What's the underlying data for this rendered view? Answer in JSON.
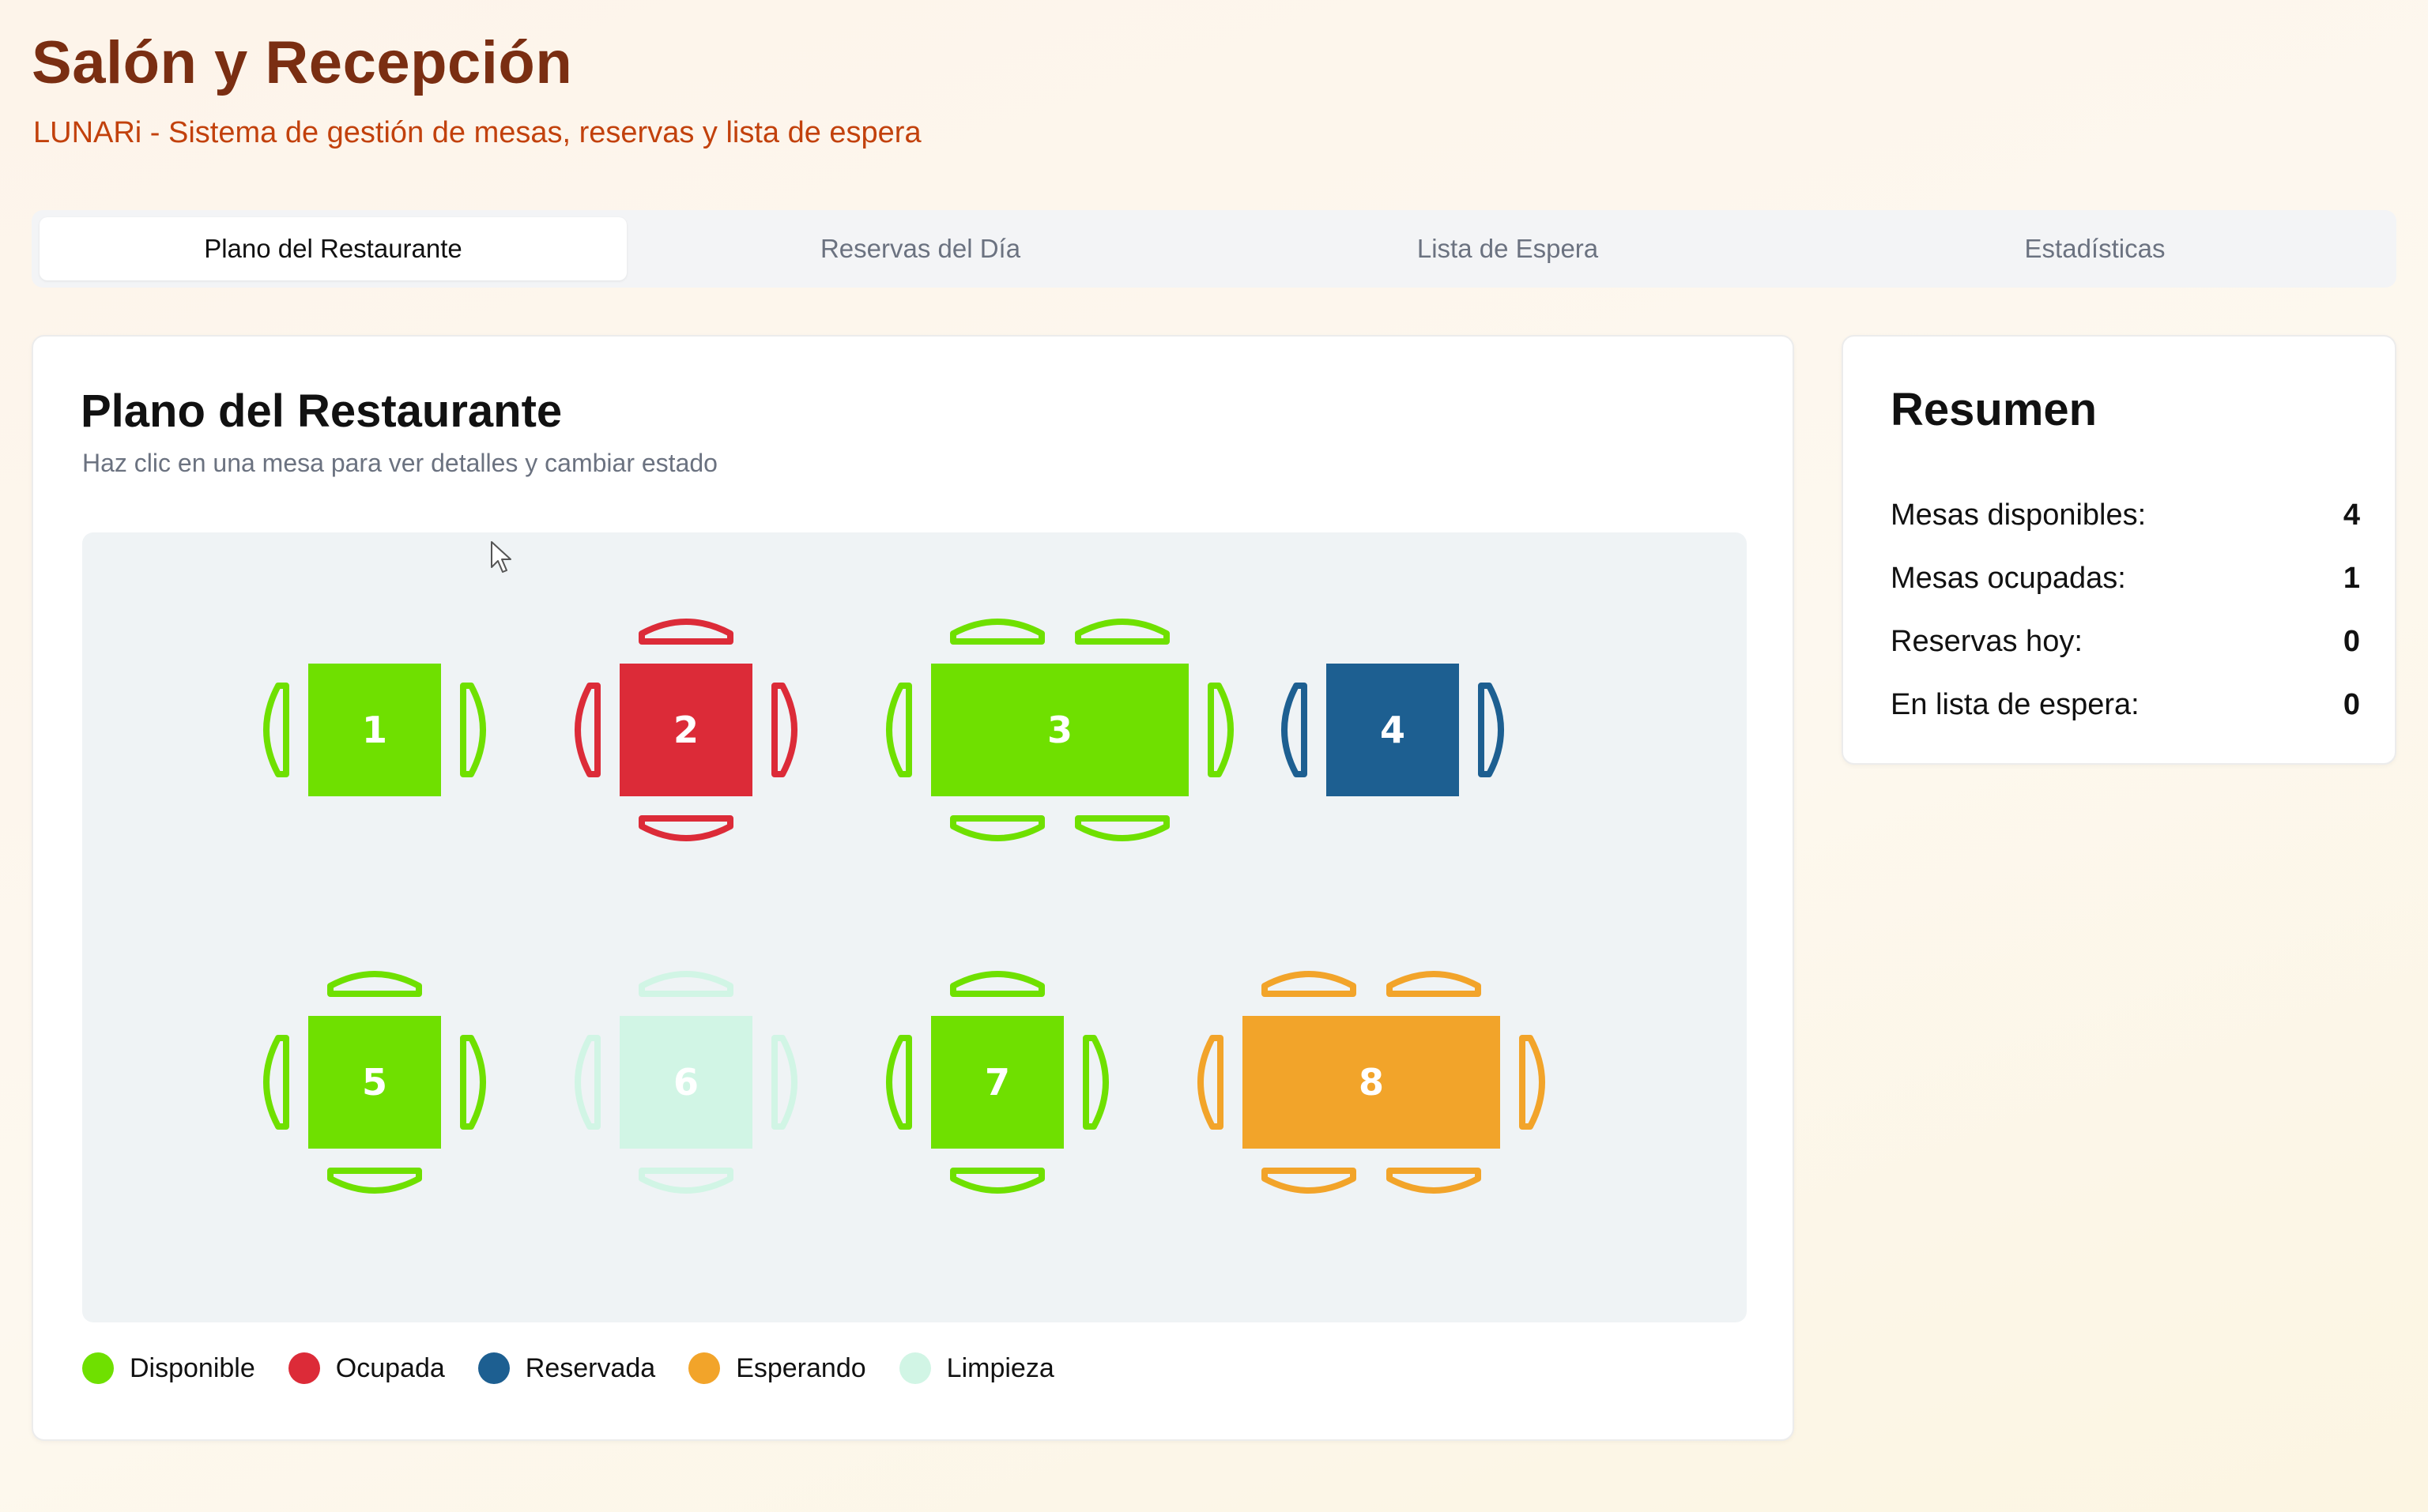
{
  "header": {
    "title": "Salón y Recepción",
    "subtitle": "LUNARi - Sistema de gestión de mesas, reservas y lista de espera"
  },
  "tabs": [
    {
      "label": "Plano del Restaurante",
      "active": true
    },
    {
      "label": "Reservas del Día",
      "active": false
    },
    {
      "label": "Lista de Espera",
      "active": false
    },
    {
      "label": "Estadísticas",
      "active": false
    }
  ],
  "floor_plan": {
    "title": "Plano del Restaurante",
    "subtitle": "Haz clic en una mesa para ver detalles y cambiar estado",
    "tables": [
      {
        "number": "1",
        "status": "disponible"
      },
      {
        "number": "2",
        "status": "ocupada"
      },
      {
        "number": "3",
        "status": "disponible"
      },
      {
        "number": "4",
        "status": "reservada"
      },
      {
        "number": "5",
        "status": "disponible"
      },
      {
        "number": "6",
        "status": "limpieza"
      },
      {
        "number": "7",
        "status": "disponible"
      },
      {
        "number": "8",
        "status": "esperando"
      }
    ]
  },
  "legend": [
    {
      "key": "disponible",
      "label": "Disponible",
      "color": "#6fe000"
    },
    {
      "key": "ocupada",
      "label": "Ocupada",
      "color": "#dc2b38"
    },
    {
      "key": "reservada",
      "label": "Reservada",
      "color": "#1d5f91"
    },
    {
      "key": "esperando",
      "label": "Esperando",
      "color": "#f2a42a"
    },
    {
      "key": "limpieza",
      "label": "Limpieza",
      "color": "#d1f5e5"
    }
  ],
  "summary": {
    "title": "Resumen",
    "rows": [
      {
        "label": "Mesas disponibles:",
        "value": "4"
      },
      {
        "label": "Mesas ocupadas:",
        "value": "1"
      },
      {
        "label": "Reservas hoy:",
        "value": "0"
      },
      {
        "label": "En lista de espera:",
        "value": "0"
      }
    ]
  }
}
